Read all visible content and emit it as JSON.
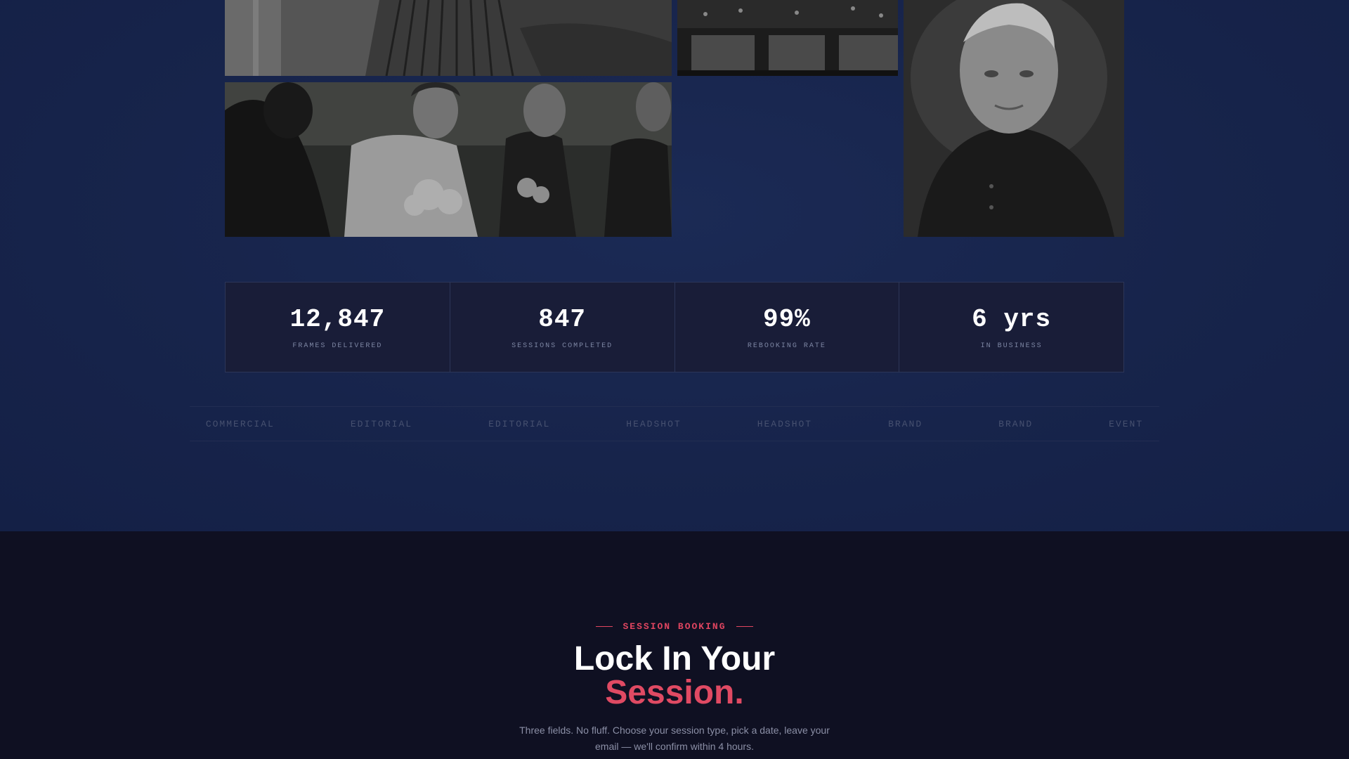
{
  "gallery": {
    "photos": [
      {
        "name": "fabric-dress-photo",
        "subject": "flowing dark dress"
      },
      {
        "name": "restaurant-interior-photo",
        "subject": "dim restaurant interior"
      },
      {
        "name": "elderly-man-portrait",
        "subject": "portrait of elderly man"
      },
      {
        "name": "bridal-party-photo",
        "subject": "bride with bridesmaids holding bouquets"
      }
    ]
  },
  "stats": [
    {
      "value": "12,847",
      "label": "FRAMES DELIVERED"
    },
    {
      "value": "847",
      "label": "SESSIONS COMPLETED"
    },
    {
      "value": "99%",
      "label": "REBOOKING RATE"
    },
    {
      "value": "6 yrs",
      "label": "IN BUSINESS"
    }
  ],
  "ticker": [
    "COMMERCIAL",
    "EDITORIAL",
    "EDITORIAL",
    "HEADSHOT",
    "HEADSHOT",
    "BRAND",
    "BRAND",
    "EVENT"
  ],
  "booking": {
    "eyebrow": "SESSION BOOKING",
    "headline_line1": "Lock In Your",
    "headline_line2": "Session.",
    "subtext": "Three fields. No fluff. Choose your session type, pick a date, leave your email — we'll confirm within 4 hours."
  },
  "colors": {
    "accent": "#e04a63",
    "top_bg": "#17244b",
    "bottom_bg": "#0f1022",
    "stat_card_bg": "#191d38"
  }
}
